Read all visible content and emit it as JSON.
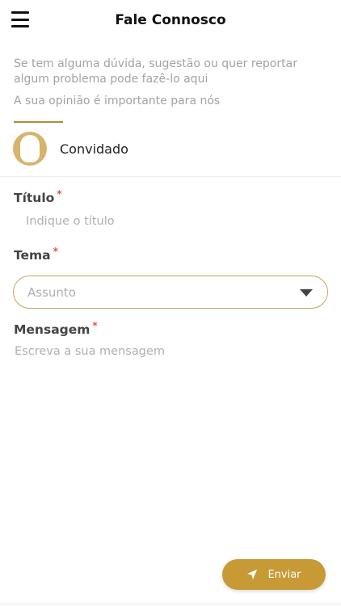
{
  "header": {
    "title": "Fale Connosco",
    "menu_icon": "hamburger-menu-icon"
  },
  "intro": {
    "text": "Se tem alguma dúvida, sugestão ou quer reportar algum problema pode fazê-lo aqui",
    "note": "A sua opinião é importante para nós"
  },
  "user": {
    "name": "Convidado",
    "avatar_icon": "user-avatar-icon"
  },
  "form": {
    "title_label": "Título",
    "title_placeholder": "Indique o título",
    "theme_label": "Tema",
    "theme_selected": "Assunto",
    "message_label": "Mensagem",
    "message_placeholder": "Escreva a sua mensagem",
    "required_mark": "*"
  },
  "actions": {
    "send_label": "Enviar",
    "send_icon": "navigation-arrow-icon"
  },
  "colors": {
    "accent": "#c79a36",
    "select_border": "#c9a45a",
    "required": "#e0533f",
    "placeholder": "#b0b0b0"
  }
}
